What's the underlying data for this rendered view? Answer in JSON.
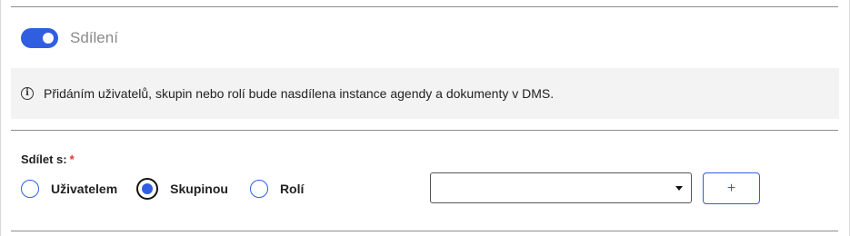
{
  "sharing": {
    "toggle_label": "Sdílení",
    "toggle_on": true,
    "toggle_icon": "toggle-switch"
  },
  "info": {
    "icon": "info-icon",
    "icon_glyph": "i",
    "text": "Přidáním uživatelů, skupin nebo rolí bude nasdílena instance agendy a dokumenty v DMS."
  },
  "share_with": {
    "label": "Sdílet s:",
    "required_marker": "*",
    "options": [
      {
        "label": "Uživatelem",
        "selected": false
      },
      {
        "label": "Skupinou",
        "selected": true
      },
      {
        "label": "Rolí",
        "selected": false
      }
    ],
    "select_value": "",
    "add_button_label": "+"
  },
  "colors": {
    "accent": "#2f5fe0",
    "required": "#e0303a",
    "info_bg": "#f3f3f3"
  }
}
